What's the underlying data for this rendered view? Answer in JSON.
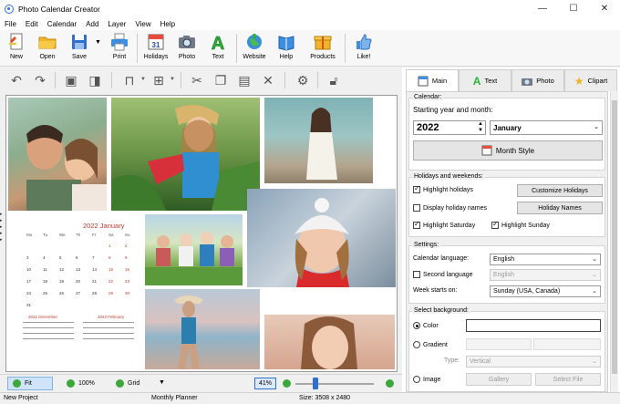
{
  "window": {
    "title": "Photo Calendar Creator",
    "minimize": "—",
    "maximize": "☐",
    "close": "✕"
  },
  "menu": [
    "File",
    "Edit",
    "Calendar",
    "Add",
    "Layer",
    "View",
    "Help"
  ],
  "toolbar": {
    "new": "New",
    "open": "Open",
    "save": "Save",
    "print": "Print",
    "holidays": "Holidays",
    "photo": "Photo",
    "text": "Text",
    "website": "Website",
    "help": "Help",
    "products": "Products",
    "like": "Like!",
    "holidays_badge": "31",
    "text_glyph": "A"
  },
  "edit_icons": [
    "undo-icon",
    "redo-icon",
    "frame-icon",
    "crop-icon",
    "align-icon",
    "layers-icon",
    "cut-icon",
    "copy-icon",
    "paste-icon",
    "delete-icon",
    "settings-icon",
    "lock-icon"
  ],
  "calendar": {
    "title": "2022 January",
    "weekdays": [
      "Mo",
      "Tu",
      "We",
      "Th",
      "Fr",
      "Sa",
      "Su"
    ],
    "days": [
      [
        "",
        "",
        "",
        "",
        "",
        "1",
        "2"
      ],
      [
        "3",
        "4",
        "5",
        "6",
        "7",
        "8",
        "9"
      ],
      [
        "10",
        "11",
        "12",
        "13",
        "14",
        "15",
        "16"
      ],
      [
        "17",
        "18",
        "19",
        "20",
        "21",
        "22",
        "23"
      ],
      [
        "24",
        "25",
        "26",
        "27",
        "28",
        "29",
        "30"
      ],
      [
        "31",
        "",
        "",
        "",
        "",
        "",
        ""
      ]
    ],
    "prev_month": "2021 December",
    "next_month": "2022 February"
  },
  "tabs": [
    {
      "label": "Main",
      "icon": "calendar-icon"
    },
    {
      "label": "Text",
      "icon": "text-icon"
    },
    {
      "label": "Photo",
      "icon": "photo-icon"
    },
    {
      "label": "Clipart",
      "icon": "star-icon"
    }
  ],
  "panel": {
    "calendar_group": "Calendar:",
    "start_label": "Starting year and month:",
    "year": "2022",
    "month": "January",
    "month_style": "Month Style",
    "holidays_group": "Holidays and weekends:",
    "highlight_holidays": "Highlight holidays",
    "customize_holidays": "Customize Holidays",
    "display_holiday_names": "Display holiday names",
    "holiday_names": "Holiday Names",
    "highlight_saturday": "Highlight Saturday",
    "highlight_sunday": "Highlight Sunday",
    "settings_group": "Settings:",
    "calendar_language_label": "Calendar language:",
    "calendar_language": "English",
    "second_language_label": "Second language",
    "second_language": "English",
    "week_starts_label": "Week starts on:",
    "week_starts": "Sunday (USA, Canada)",
    "background_group": "Select background:",
    "color_label": "Color",
    "gradient_label": "Gradient",
    "type_label": "Type:",
    "type_value": "Vertical",
    "image_label": "Image",
    "gallery": "Gallery",
    "select_file": "Select File"
  },
  "bottom": {
    "fit": "Fit",
    "zoom100": "100%",
    "grid": "Grid",
    "zoom_value": "41%"
  },
  "status": {
    "project": "New Project",
    "layout": "Monthly Planner",
    "size": "Size: 3508 x 2480"
  }
}
